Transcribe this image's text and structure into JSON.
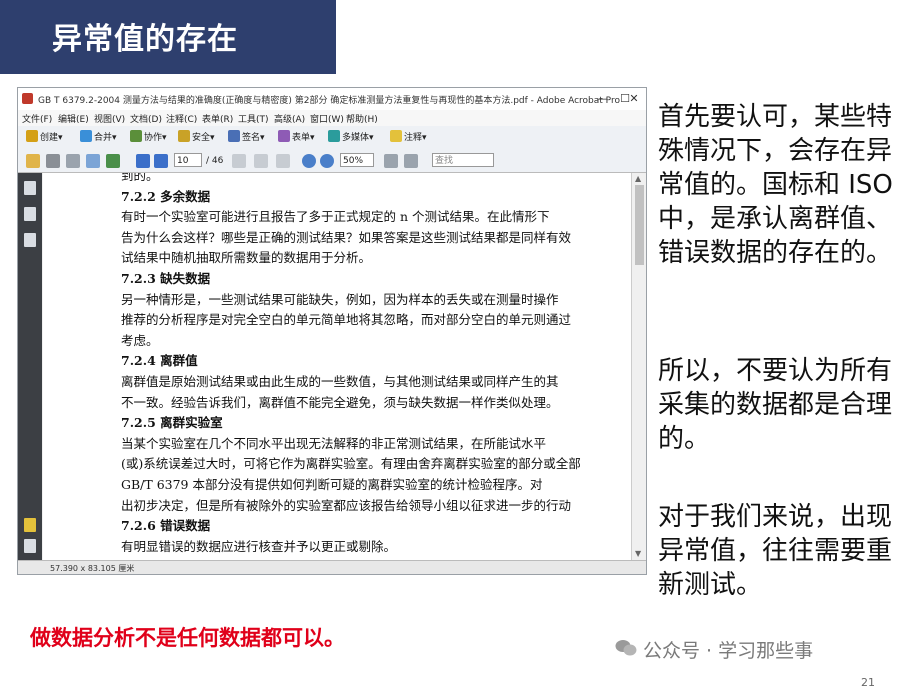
{
  "slide": {
    "title": "异常值的存在",
    "right_paragraphs": [
      "首先要认可，某些特殊情况下，会存在异常值的。国标和 ISO 中，是承认离群值、错误数据的存在的。",
      "所以，不要认为所有采集的数据都是合理的。",
      "对于我们来说，出现异常值，往往需要重新测试。"
    ],
    "bottom_note": "做数据分析不是任何数据都可以。",
    "watermark": "公众号 · 学习那些事",
    "page_number": "21"
  },
  "window": {
    "title": "GB T 6379.2-2004 测量方法与结果的准确度(正确度与精密度) 第2部分 确定标准测量方法重复性与再现性的基本方法.pdf - Adobe Acrobat Pro",
    "controls": [
      "—",
      "☐",
      "✕"
    ],
    "menu": [
      "文件(F)",
      "编辑(E)",
      "视图(V)",
      "文档(D)",
      "注释(C)",
      "表单(R)",
      "工具(T)",
      "高级(A)",
      "窗口(W)",
      "帮助(H)"
    ],
    "toolbar1": [
      "创建",
      "合并",
      "协作",
      "安全",
      "签名",
      "表单",
      "多媒体",
      "注释"
    ],
    "page_current": "10",
    "page_total": "/ 46",
    "zoom": "50%",
    "search_placeholder": "查找",
    "status": "57.390 x 83.105 厘米"
  },
  "document_lines": [
    {
      "text": "到的。",
      "bold": false
    },
    {
      "text": "7.2.2   多余数据",
      "bold": true
    },
    {
      "text": "        有时一个实验室可能进行且报告了多于正式规定的 n 个测试结果。在此情形下",
      "bold": false
    },
    {
      "text": "告为什么会这样？哪些是正确的测试结果？如果答案是这些测试结果都是同样有效",
      "bold": false
    },
    {
      "text": "试结果中随机抽取所需数量的数据用于分析。",
      "bold": false
    },
    {
      "text": "7.2.3   缺失数据",
      "bold": true
    },
    {
      "text": "        另一种情形是，一些测试结果可能缺失，例如，因为样本的丢失或在测量时操作",
      "bold": false
    },
    {
      "text": "推荐的分析程序是对完全空白的单元简单地将其忽略，而对部分空白的单元则通过",
      "bold": false
    },
    {
      "text": "考虑。",
      "bold": false
    },
    {
      "text": "7.2.4   离群值",
      "bold": true
    },
    {
      "text": "        离群值是原始测试结果或由此生成的一些数值，与其他测试结果或同样产生的其",
      "bold": false
    },
    {
      "text": "不一致。经验告诉我们，离群值不能完全避免，须与缺失数据一样作类似处理。",
      "bold": false
    },
    {
      "text": "7.2.5   离群实验室",
      "bold": true
    },
    {
      "text": "        当某个实验室在几个不同水平出现无法解释的非正常测试结果，在所能试水平",
      "bold": false
    },
    {
      "text": "(或)系统误差过大时，可将它作为离群实验室。有理由舍弃离群实验室的部分或全部",
      "bold": false
    },
    {
      "text": "        GB/T 6379 本部分没有提供如何判断可疑的离群实验室的统计检验程序。对",
      "bold": false
    },
    {
      "text": "出初步决定，但是所有被除外的实验室都应该报告给领导小组以征求进一步的行动",
      "bold": false
    },
    {
      "text": "7.2.6   错误数据",
      "bold": true
    },
    {
      "text": "        有明显错误的数据应进行核查并予以更正或剔除。",
      "bold": false
    }
  ],
  "colors": {
    "title_bg": "#2e3f6e",
    "note_red": "#e0001a"
  }
}
